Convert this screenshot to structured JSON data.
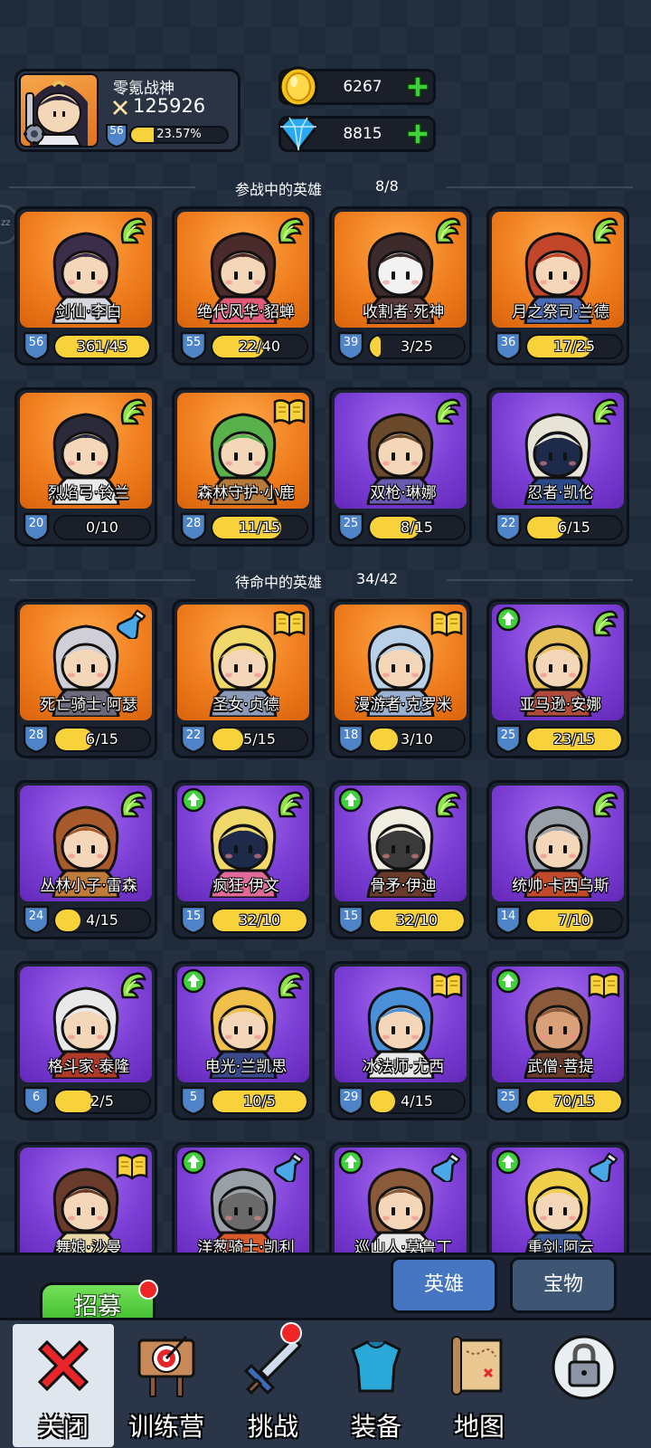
{
  "player": {
    "name": "零氪战神",
    "power": "125926",
    "level": "56",
    "exp_percent_text": "23.57%",
    "exp_fraction": 0.2357
  },
  "currency": {
    "gold": "6267",
    "gems": "8815"
  },
  "sections": {
    "active": {
      "title": "参战中的英雄",
      "count": "8/8"
    },
    "standby": {
      "title": "待命中的英雄",
      "count": "34/42"
    }
  },
  "active_heroes": [
    {
      "name": "剑仙·李白",
      "level": "56",
      "progress": "361/45",
      "fill": 1.0,
      "bg": "orange",
      "badge": "wing",
      "upgrade": false,
      "colors": [
        "#3a2e4a",
        "#f3d7b8",
        "#d8d8e0"
      ]
    },
    {
      "name": "绝代风华·貂蝉",
      "level": "55",
      "progress": "22/40",
      "fill": 0.55,
      "bg": "orange",
      "badge": "wing",
      "upgrade": false,
      "colors": [
        "#4a2a2a",
        "#f3d7b8",
        "#e25a7a"
      ]
    },
    {
      "name": "收割者·死神",
      "level": "39",
      "progress": "3/25",
      "fill": 0.12,
      "bg": "orange",
      "badge": "wing",
      "upgrade": false,
      "colors": [
        "#3d2a2a",
        "#f2f2f2",
        "#5a3a3a"
      ]
    },
    {
      "name": "月之祭司·兰德",
      "level": "36",
      "progress": "17/25",
      "fill": 0.68,
      "bg": "orange",
      "badge": "wing",
      "upgrade": false,
      "colors": [
        "#c2462a",
        "#f3d7b8",
        "#4a6ab8"
      ]
    },
    {
      "name": "烈焰弓·铃兰",
      "level": "20",
      "progress": "0/10",
      "fill": 0.0,
      "bg": "orange",
      "badge": "wing",
      "upgrade": false,
      "colors": [
        "#2a2a3a",
        "#f3d7b8",
        "#e9e9e9"
      ]
    },
    {
      "name": "森林守护·小鹿",
      "level": "28",
      "progress": "11/15",
      "fill": 0.73,
      "bg": "orange",
      "badge": "book",
      "upgrade": false,
      "colors": [
        "#58b14a",
        "#f3d7b8",
        "#b87a3a"
      ]
    },
    {
      "name": "双枪·琳娜",
      "level": "25",
      "progress": "8/15",
      "fill": 0.53,
      "bg": "purple",
      "badge": "wing",
      "upgrade": false,
      "colors": [
        "#6a4a2a",
        "#f3d7b8",
        "#6a5ab0"
      ]
    },
    {
      "name": "忍者·凯伦",
      "level": "22",
      "progress": "6/15",
      "fill": 0.4,
      "bg": "purple",
      "badge": "wing",
      "upgrade": false,
      "colors": [
        "#e9e4d8",
        "#1d2a4a",
        "#2a4a8a"
      ]
    }
  ],
  "standby_heroes": [
    {
      "name": "死亡骑士·阿瑟",
      "level": "28",
      "progress": "6/15",
      "fill": 0.4,
      "bg": "orange",
      "badge": "potion",
      "upgrade": false,
      "colors": [
        "#cfcfd8",
        "#f3d7b8",
        "#6a6a7a"
      ]
    },
    {
      "name": "圣女·贞德",
      "level": "22",
      "progress": "5/15",
      "fill": 0.33,
      "bg": "orange",
      "badge": "book",
      "upgrade": false,
      "colors": [
        "#f0d86a",
        "#f3d7b8",
        "#8a9ab8"
      ]
    },
    {
      "name": "漫游者·克罗米",
      "level": "18",
      "progress": "3/10",
      "fill": 0.3,
      "bg": "orange",
      "badge": "book",
      "upgrade": false,
      "colors": [
        "#b8d0e8",
        "#f3d7b8",
        "#9ab0d0"
      ]
    },
    {
      "name": "亚马逊·安娜",
      "level": "25",
      "progress": "23/15",
      "fill": 1.0,
      "bg": "purple",
      "badge": "wing",
      "upgrade": true,
      "colors": [
        "#e8c05a",
        "#f3d7b8",
        "#b04a3a"
      ]
    },
    {
      "name": "丛林小子·雷森",
      "level": "24",
      "progress": "4/15",
      "fill": 0.27,
      "bg": "purple",
      "badge": "wing",
      "upgrade": false,
      "colors": [
        "#a85a2a",
        "#f3d7b8",
        "#c07a3a"
      ]
    },
    {
      "name": "疯狂·伊文",
      "level": "15",
      "progress": "32/10",
      "fill": 1.0,
      "bg": "purple",
      "badge": "wing",
      "upgrade": true,
      "colors": [
        "#f0d86a",
        "#1d2a4a",
        "#e26a9a"
      ]
    },
    {
      "name": "骨矛·伊迪",
      "level": "15",
      "progress": "32/10",
      "fill": 1.0,
      "bg": "purple",
      "badge": "wing",
      "upgrade": true,
      "colors": [
        "#f0ece0",
        "#3a3a3a",
        "#6a3a2a"
      ]
    },
    {
      "name": "统帅·卡西乌斯",
      "level": "14",
      "progress": "7/10",
      "fill": 0.7,
      "bg": "purple",
      "badge": "wing",
      "upgrade": false,
      "colors": [
        "#9aa0a8",
        "#f3d7b8",
        "#c04a2a"
      ]
    },
    {
      "name": "格斗家·泰隆",
      "level": "6",
      "progress": "2/5",
      "fill": 0.4,
      "bg": "purple",
      "badge": "wing",
      "upgrade": false,
      "colors": [
        "#e9e9e9",
        "#f3d7b8",
        "#b03a2a"
      ]
    },
    {
      "name": "电光·兰凯思",
      "level": "5",
      "progress": "10/5",
      "fill": 1.0,
      "bg": "purple",
      "badge": "wing",
      "upgrade": true,
      "colors": [
        "#f0c04a",
        "#f3d7b8",
        "#3a4a8a"
      ]
    },
    {
      "name": "冰法师·尤西",
      "level": "29",
      "progress": "4/15",
      "fill": 0.27,
      "bg": "purple",
      "badge": "book",
      "upgrade": false,
      "colors": [
        "#4a90d8",
        "#f3d7b8",
        "#e9e9e9"
      ]
    },
    {
      "name": "武僧·菩提",
      "level": "25",
      "progress": "70/15",
      "fill": 1.0,
      "bg": "purple",
      "badge": "book",
      "upgrade": true,
      "colors": [
        "#8a5a3a",
        "#d9a07a",
        "#6a3a2a"
      ]
    },
    {
      "name": "舞娘·沙曼",
      "level": "",
      "progress": "",
      "fill": 0,
      "bg": "purple",
      "badge": "book",
      "upgrade": false,
      "colors": [
        "#6a3a2a",
        "#f3d7b8",
        "#e9d8a8"
      ]
    },
    {
      "name": "洋葱骑士·凯利",
      "level": "",
      "progress": "",
      "fill": 0,
      "bg": "purple",
      "badge": "potion",
      "upgrade": true,
      "colors": [
        "#9aa0a8",
        "#6a6a6a",
        "#d85a2a"
      ]
    },
    {
      "name": "巡山人·莫鲁丁",
      "level": "",
      "progress": "",
      "fill": 0,
      "bg": "purple",
      "badge": "potion",
      "upgrade": true,
      "colors": [
        "#8a5a3a",
        "#f3d7b8",
        "#e9e9e9"
      ]
    },
    {
      "name": "重剑·阿云",
      "level": "",
      "progress": "",
      "fill": 0,
      "bg": "purple",
      "badge": "potion",
      "upgrade": true,
      "colors": [
        "#f0d04a",
        "#f3d7b8",
        "#3a5a9a"
      ]
    }
  ],
  "bottom": {
    "recruit_label": "招募",
    "tab_heroes": "英雄",
    "tab_treasure": "宝物"
  },
  "nav": [
    {
      "label": "关闭",
      "icon": "close-icon"
    },
    {
      "label": "训练营",
      "icon": "target-icon"
    },
    {
      "label": "挑战",
      "icon": "sword-icon"
    },
    {
      "label": "装备",
      "icon": "armor-icon"
    },
    {
      "label": "地图",
      "icon": "map-icon"
    },
    {
      "label": "",
      "icon": "lock-icon"
    }
  ],
  "side_handle": "zz",
  "colors": {
    "accent_yellow": "#f7d23a",
    "orange_card": "#f07e1e",
    "purple_card": "#7c3fd6",
    "green_plus": "#3ed13a",
    "tab_active": "#4676c2"
  }
}
